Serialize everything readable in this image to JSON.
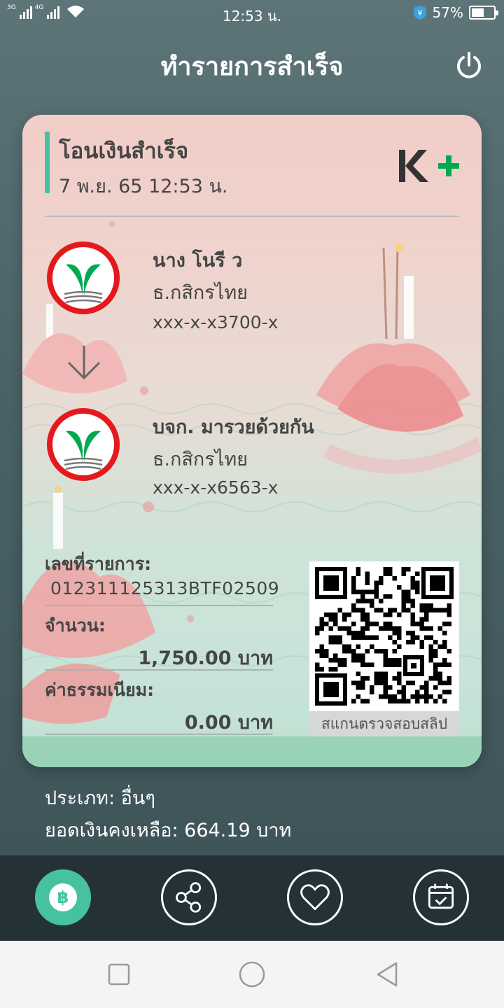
{
  "status_bar": {
    "net1": "3G",
    "net2": "4G",
    "time": "12:53 น.",
    "battery_percent_text": "57%",
    "battery_level": 0.57,
    "icons": [
      "signal-icon",
      "wifi-icon",
      "shield-icon",
      "battery-icon"
    ]
  },
  "header": {
    "title": "ทำรายการสำเร็จ",
    "power_icon": "power-icon"
  },
  "slip": {
    "title": "โอนเงินสำเร็จ",
    "datetime": "7 พ.ย. 65  12:53 น.",
    "brand_logo": "K+",
    "colors": {
      "accent": "#47c2a1",
      "brand_dark": "#333333",
      "brand_green": "#00a950",
      "logo_ring": "#e4191e"
    },
    "sender": {
      "name": "นาง โนรี ว",
      "bank": "ธ.กสิกรไทย",
      "account": "xxx-x-x3700-x"
    },
    "receiver": {
      "name": "บจก. มารวยด้วยกัน",
      "bank": "ธ.กสิกรไทย",
      "account": "xxx-x-x6563-x"
    },
    "ref_label": "เลขที่รายการ:",
    "ref_value": "012311125313BTF02509",
    "amount_label": "จำนวน:",
    "amount_value": "1,750.00 บาท",
    "fee_label": "ค่าธรรมเนียม:",
    "fee_value": "0.00 บาท",
    "qr_caption": "สแกนตรวจสอบสลิป"
  },
  "info": {
    "type_line": "ประเภท: อื่นๆ",
    "balance_line": "ยอดเงินคงเหลือ: 664.19 บาท"
  },
  "actions": [
    {
      "icon": "baht-icon"
    },
    {
      "icon": "share-icon"
    },
    {
      "icon": "heart-icon"
    },
    {
      "icon": "calendar-check-icon"
    }
  ],
  "nav": [
    "recent-apps-icon",
    "home-icon",
    "back-icon"
  ]
}
